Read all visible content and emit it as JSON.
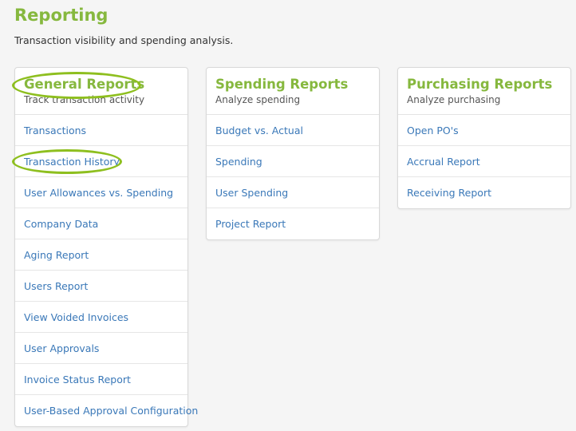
{
  "page": {
    "title": "Reporting",
    "subtitle": "Transaction visibility and spending analysis."
  },
  "cards": [
    {
      "title": "General Reports",
      "subtitle": "Track transaction activity",
      "items": [
        "Transactions",
        "Transaction History",
        "User Allowances vs. Spending",
        "Company Data",
        "Aging Report",
        "Users Report",
        "View Voided Invoices",
        "User Approvals",
        "Invoice Status Report",
        "User-Based Approval Configuration"
      ]
    },
    {
      "title": "Spending Reports",
      "subtitle": "Analyze spending",
      "items": [
        "Budget vs. Actual",
        "Spending",
        "User Spending",
        "Project Report"
      ]
    },
    {
      "title": "Purchasing Reports",
      "subtitle": "Analyze purchasing",
      "items": [
        "Open PO's",
        "Accrual Report",
        "Receiving Report"
      ]
    }
  ],
  "colors": {
    "accent": "#86b83e",
    "link": "#3a78b8",
    "highlight": "#8ebf1f"
  }
}
